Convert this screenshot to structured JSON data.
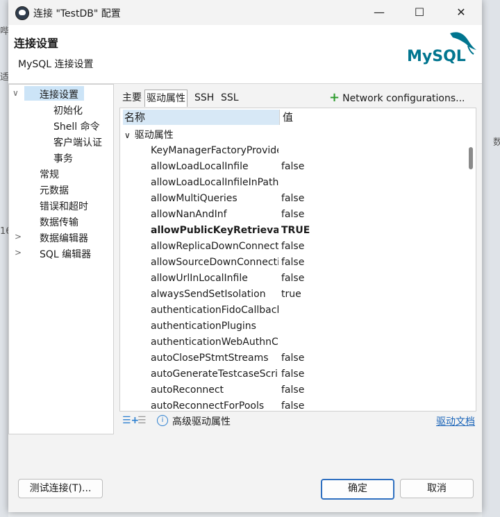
{
  "background": {
    "left_fragments": [
      "哔",
      "适",
      "16"
    ],
    "right_fragment": "数"
  },
  "window": {
    "title": "连接 \"TestDB\" 配置",
    "minimize": "—",
    "maximize": "☐",
    "close": "✕"
  },
  "header": {
    "title": "连接设置",
    "subtitle": "MySQL 连接设置",
    "logo_text": "MySQL",
    "logo_color": "#00758f",
    "logo_accent": "#f29111"
  },
  "tree": {
    "items": [
      {
        "label": "连接设置",
        "arrow": "∨",
        "selected": true
      },
      {
        "label": "初始化"
      },
      {
        "label": "Shell 命令"
      },
      {
        "label": "客户端认证"
      },
      {
        "label": "事务"
      },
      {
        "label": "常规"
      },
      {
        "label": "元数据"
      },
      {
        "label": "错误和超时"
      },
      {
        "label": "数据传输"
      },
      {
        "label": "数据编辑器",
        "arrow": ">"
      },
      {
        "label": "SQL 编辑器",
        "arrow": ">"
      }
    ]
  },
  "tabs": [
    {
      "label": "主要"
    },
    {
      "label": "驱动属性",
      "selected": true
    },
    {
      "label": "SSH"
    },
    {
      "label": "SSL"
    }
  ],
  "network_button": "Network configurations...",
  "table": {
    "headers": [
      "名称",
      "值"
    ],
    "group": "驱动属性",
    "rows": [
      {
        "name": "KeyManagerFactoryProvider",
        "value": ""
      },
      {
        "name": "allowLoadLocalInfile",
        "value": "false"
      },
      {
        "name": "allowLoadLocalInfileInPath",
        "value": ""
      },
      {
        "name": "allowMultiQueries",
        "value": "false"
      },
      {
        "name": "allowNanAndInf",
        "value": "false"
      },
      {
        "name": "allowPublicKeyRetrieval",
        "value": "TRUE",
        "bold": true
      },
      {
        "name": "allowReplicaDownConnections",
        "value": "false"
      },
      {
        "name": "allowSourceDownConnections",
        "value": "false"
      },
      {
        "name": "allowUrlInLocalInfile",
        "value": "false"
      },
      {
        "name": "alwaysSendSetIsolation",
        "value": "true"
      },
      {
        "name": "authenticationFidoCallbackHandler",
        "value": ""
      },
      {
        "name": "authenticationPlugins",
        "value": ""
      },
      {
        "name": "authenticationWebAuthnCallbackHandler",
        "value": ""
      },
      {
        "name": "autoClosePStmtStreams",
        "value": "false"
      },
      {
        "name": "autoGenerateTestcaseScript",
        "value": "false"
      },
      {
        "name": "autoReconnect",
        "value": "false"
      },
      {
        "name": "autoReconnectForPools",
        "value": "false"
      }
    ]
  },
  "footer": {
    "advanced": "高级驱动属性",
    "doc_link": "驱动文档"
  },
  "buttons": {
    "test": "测试连接(T)...",
    "ok": "确定",
    "cancel": "取消"
  }
}
